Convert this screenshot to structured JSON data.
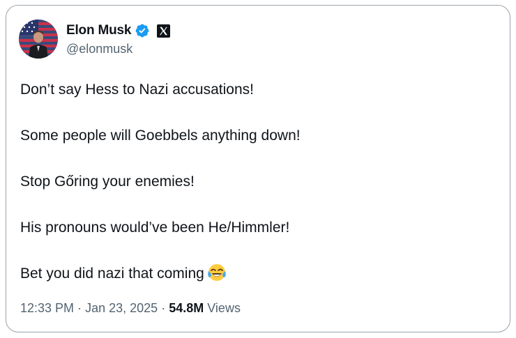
{
  "author": {
    "display_name": "Elon Musk",
    "handle": "@elonmusk",
    "avatar_icon": "profile-photo",
    "verified_icon": "verified-badge-icon",
    "affiliate_icon": "x-logo-icon"
  },
  "tweet": {
    "lines": [
      "Don’t say Hess to Nazi accusations!",
      "Some people will Goebbels anything down!",
      "Stop Gőring your enemies!",
      "His pronouns would’ve been He/Himmler!",
      "Bet you did nazi that coming"
    ],
    "emoji": "tears-of-joy-emoji"
  },
  "meta": {
    "time": "12:33 PM",
    "separator": "·",
    "date": "Jan 23, 2025",
    "views_count": "54.8M",
    "views_label": "Views"
  },
  "colors": {
    "text": "#0f1419",
    "secondary": "#536471",
    "verified_blue": "#1d9bf0",
    "border": "#9aa3ab"
  }
}
